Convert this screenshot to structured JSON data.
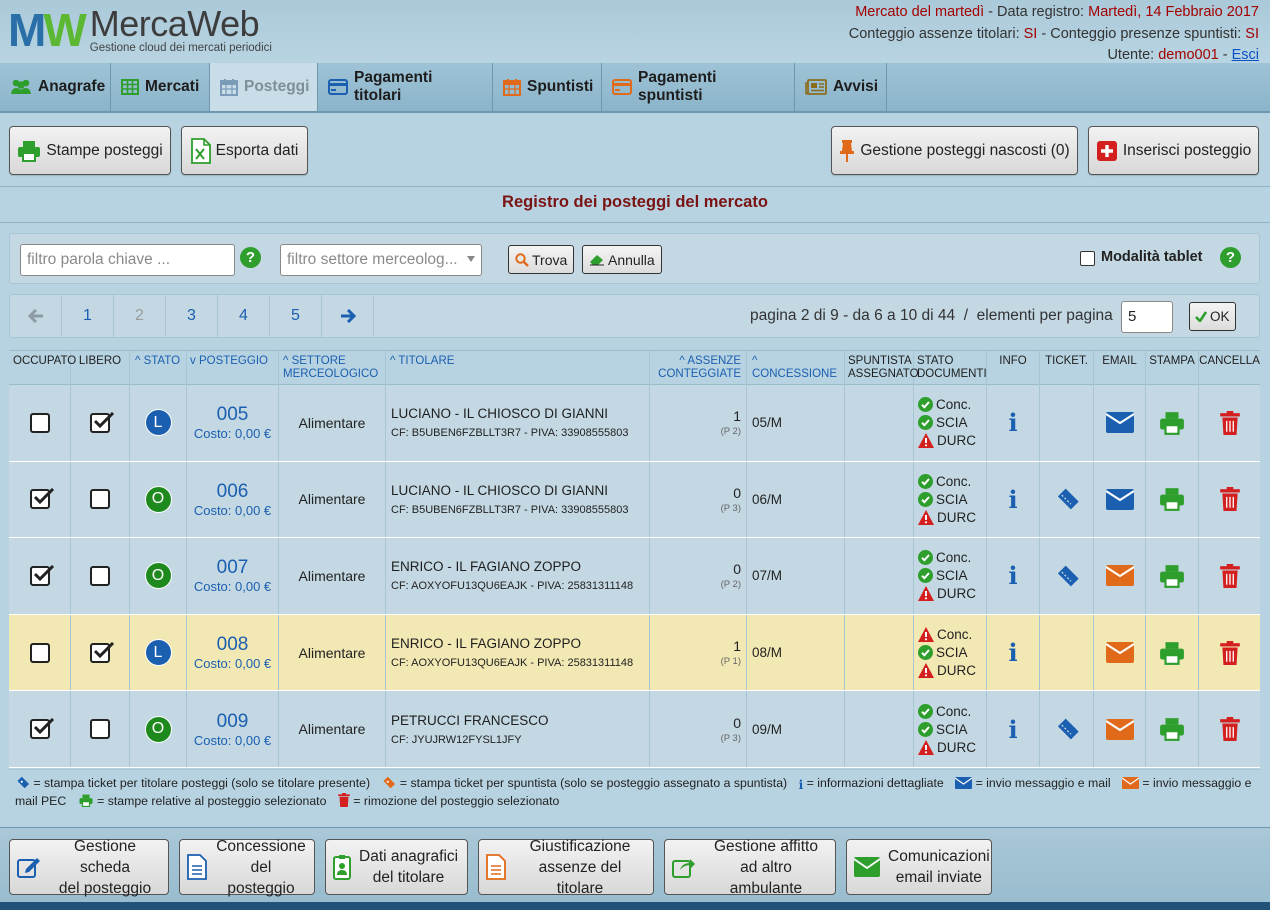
{
  "app": {
    "logo_mark": "MW",
    "logo_title_a": "Merca",
    "logo_title_b": "Web",
    "logo_subtitle": "Gestione cloud dei mercati periodici"
  },
  "header": {
    "market": "Mercato del martedì",
    "date_label": " - Data registro: ",
    "date_value": "Martedì, 14 Febbraio 2017",
    "abs_label": "Conteggio assenze titolari: ",
    "abs_value": "SI",
    "pres_label": " - Conteggio presenze spuntisti: ",
    "pres_value": "SI",
    "user_label": "Utente: ",
    "user_value": "demo001",
    "sep": " - ",
    "logout": "Esci"
  },
  "nav": {
    "items": [
      {
        "label": "Anagrafe",
        "icon": "users-icon"
      },
      {
        "label": "Mercati",
        "icon": "table-icon"
      },
      {
        "label": "Posteggi",
        "icon": "calendar-icon"
      },
      {
        "label": "Pagamenti titolari",
        "icon": "credit-card-icon"
      },
      {
        "label": "Spuntisti",
        "icon": "calendar-icon"
      },
      {
        "label": "Pagamenti spuntisti",
        "icon": "credit-card-icon"
      },
      {
        "label": "Avvisi",
        "icon": "newspaper-icon"
      }
    ]
  },
  "toolbar": {
    "print_label": "Stampe posteggi",
    "export_label": "Esporta dati",
    "hidden_label": "Gestione posteggi nascosti (0)",
    "insert_label": "Inserisci posteggio"
  },
  "register_title": "Registro dei posteggi del mercato",
  "filter": {
    "keyword_placeholder": "filtro parola chiave ...",
    "sector_placeholder": "filtro settore merceolog...",
    "find_label": "Trova",
    "cancel_label": "Annulla",
    "tablet_label": "Modalità tablet"
  },
  "pagination": {
    "pages": [
      "1",
      "2",
      "3",
      "4",
      "5"
    ],
    "current": "2",
    "info": "pagina 2 di 9 - da 6 a 10 di 44  /  elementi per pagina",
    "per_page": "5",
    "ok_label": "OK"
  },
  "table": {
    "headers": {
      "occupato": "OCCUPATO",
      "libero": "LIBERO",
      "stato": "STATO",
      "posteggio": "POSTEGGIO",
      "settore": "SETTORE MERCEOLOGICO",
      "titolare": "TITOLARE",
      "assenze": "ASSENZE CONTEGGIATE",
      "concessione": "CONCESSIONE",
      "spuntista": "SPUNTISTA ASSEGNATO",
      "stato_doc": "STATO DOCUMENTI",
      "info": "INFO",
      "ticket": "TICKET.",
      "email": "EMAIL",
      "stampa": "STAMPA",
      "cancella": "CANCELLA"
    },
    "rows": [
      {
        "occupato": false,
        "libero": true,
        "stato": "L",
        "numero": "005",
        "costo": "Costo: 0,00 €",
        "settore": "Alimentare",
        "titolare": "LUCIANO - IL CHIOSCO DI GIANNI",
        "cf": "CF: B5UBEN6FZBLLT3R7 - PIVA: 33908555803",
        "assenze": "1",
        "presenze": "(P 2)",
        "concessione": "05/M",
        "docs": [
          {
            "label": "Conc.",
            "ok": true
          },
          {
            "label": "SCIA",
            "ok": true
          },
          {
            "label": "DURC",
            "ok": false
          }
        ],
        "ticket": false,
        "email_color": "#1b5fb0",
        "highlight": false
      },
      {
        "occupato": true,
        "libero": false,
        "stato": "O",
        "numero": "006",
        "costo": "Costo: 0,00 €",
        "settore": "Alimentare",
        "titolare": "LUCIANO - IL CHIOSCO DI GIANNI",
        "cf": "CF: B5UBEN6FZBLLT3R7 - PIVA: 33908555803",
        "assenze": "0",
        "presenze": "(P 3)",
        "concessione": "06/M",
        "docs": [
          {
            "label": "Conc.",
            "ok": true
          },
          {
            "label": "SCIA",
            "ok": true
          },
          {
            "label": "DURC",
            "ok": false
          }
        ],
        "ticket": true,
        "email_color": "#1b5fb0",
        "highlight": false
      },
      {
        "occupato": true,
        "libero": false,
        "stato": "O",
        "numero": "007",
        "costo": "Costo: 0,00 €",
        "settore": "Alimentare",
        "titolare": "ENRICO - IL FAGIANO ZOPPO",
        "cf": "CF: AOXYOFU13QU6EAJK - PIVA: 25831311148",
        "assenze": "0",
        "presenze": "(P 2)",
        "concessione": "07/M",
        "docs": [
          {
            "label": "Conc.",
            "ok": true
          },
          {
            "label": "SCIA",
            "ok": true
          },
          {
            "label": "DURC",
            "ok": false
          }
        ],
        "ticket": true,
        "email_color": "#e06a1a",
        "highlight": false
      },
      {
        "occupato": false,
        "libero": true,
        "stato": "L",
        "numero": "008",
        "costo": "Costo: 0,00 €",
        "settore": "Alimentare",
        "titolare": "ENRICO - IL FAGIANO ZOPPO",
        "cf": "CF: AOXYOFU13QU6EAJK - PIVA: 25831311148",
        "assenze": "1",
        "presenze": "(P 1)",
        "concessione": "08/M",
        "docs": [
          {
            "label": "Conc.",
            "ok": false
          },
          {
            "label": "SCIA",
            "ok": true
          },
          {
            "label": "DURC",
            "ok": false
          }
        ],
        "ticket": false,
        "email_color": "#e06a1a",
        "highlight": true
      },
      {
        "occupato": true,
        "libero": false,
        "stato": "O",
        "numero": "009",
        "costo": "Costo: 0,00 €",
        "settore": "Alimentare",
        "titolare": "PETRUCCI FRANCESCO",
        "cf": "CF: JYUJRW12FYSL1JFY",
        "assenze": "0",
        "presenze": "(P 3)",
        "concessione": "09/M",
        "docs": [
          {
            "label": "Conc.",
            "ok": true
          },
          {
            "label": "SCIA",
            "ok": true
          },
          {
            "label": "DURC",
            "ok": false
          }
        ],
        "ticket": true,
        "email_color": "#e06a1a",
        "highlight": false
      }
    ]
  },
  "legend": {
    "ticket_tit": "= stampa ticket per titolare posteggi (solo se titolare presente)",
    "ticket_spu": "= stampa ticket per spuntista (solo se posteggio assegnato a spuntista)",
    "info": "= informazioni dettagliate",
    "email": "= invio messaggio e mail",
    "pec": "= invio messaggio e mail PEC",
    "print": "= stampe relative al posteggio selezionato",
    "delete": "= rimozione del posteggio selezionato"
  },
  "footer": {
    "buttons": [
      {
        "l1": "Gestione scheda",
        "l2": "del posteggio"
      },
      {
        "l1": "Concessione",
        "l2": "del posteggio"
      },
      {
        "l1": "Dati anagrafici",
        "l2": "del titolare"
      },
      {
        "l1": "Giustificazione",
        "l2": "assenze del titolare"
      },
      {
        "l1": "Gestione affitto",
        "l2": "ad altro ambulante"
      },
      {
        "l1": "Comunicazioni",
        "l2": "email inviate"
      }
    ]
  },
  "colors": {
    "accent_blue": "#1b5fb0",
    "ok_green": "#2e9e2c",
    "warn_red": "#d41f1f",
    "orange": "#e06a1a",
    "highlight_row": "#f2e8b3"
  }
}
